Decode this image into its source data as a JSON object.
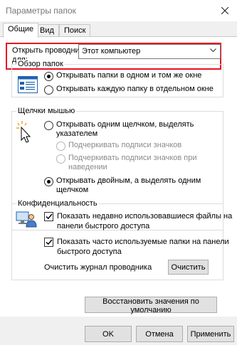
{
  "window": {
    "title": "Параметры папок"
  },
  "tabs": [
    {
      "label": "Общие",
      "active": true
    },
    {
      "label": "Вид",
      "active": false
    },
    {
      "label": "Поиск",
      "active": false
    }
  ],
  "open_explorer": {
    "label_line1": "Открыть проводник",
    "label_line2": "для:",
    "value": "Этот компьютер"
  },
  "browse_folders": {
    "title": "Обзор папок",
    "options": [
      {
        "label": "Открывать папки в одном и том же окне",
        "selected": true
      },
      {
        "label": "Открывать каждую папку в отдельном окне",
        "selected": false
      }
    ]
  },
  "click_items": {
    "title": "Щелчки мышью",
    "single_click": {
      "line1": "Открывать одним щелчком, выделять",
      "line2": "указателем",
      "selected": false
    },
    "underline_always": {
      "label": "Подчеркивать подписи значков",
      "enabled": false
    },
    "underline_hover": {
      "line1": "Подчеркивать подписи значков при",
      "line2": "наведении",
      "enabled": false
    },
    "double_click": {
      "line1": "Открывать двойным, а выделять одним",
      "line2": "щелчком",
      "selected": true
    }
  },
  "privacy": {
    "title": "Конфиденциальность",
    "recent_files": {
      "line1": "Показать недавно использовавшиеся файлы на",
      "line2": "панели быстрого доступа",
      "checked": true
    },
    "frequent_folders": {
      "line1": "Показать часто используемые папки на панели",
      "line2": "быстрого доступа",
      "checked": true
    },
    "clear_label": "Очистить журнал проводника",
    "clear_button": "Очистить"
  },
  "restore_defaults_button": "Восстановить значения по умолчанию",
  "footer": {
    "ok": "OK",
    "cancel": "Отмена",
    "apply": "Применить"
  },
  "colors": {
    "highlight": "#e81123",
    "icon_blue": "#1e63b5",
    "dialog_bg": "#f0f0f0"
  },
  "icons": [
    "close-icon",
    "chevron-down-icon",
    "folder-window-icon",
    "cursor-click-icon",
    "privacy-icon",
    "check-icon"
  ]
}
